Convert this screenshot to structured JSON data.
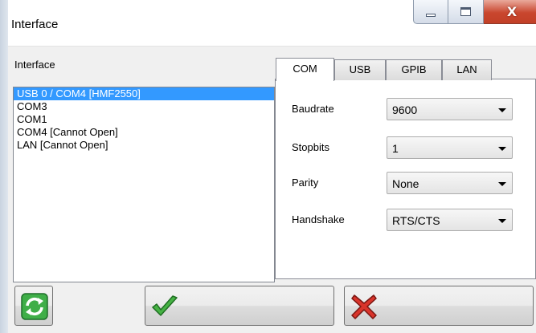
{
  "window": {
    "title": "Interface",
    "close_glyph": "X"
  },
  "interface_panel": {
    "label": "Interface",
    "items": [
      {
        "label": "USB 0 / COM4 [HMF2550]",
        "selected": true
      },
      {
        "label": "COM3",
        "selected": false
      },
      {
        "label": "COM1",
        "selected": false
      },
      {
        "label": "COM4 [Cannot Open]",
        "selected": false
      },
      {
        "label": "LAN [Cannot Open]",
        "selected": false
      }
    ]
  },
  "tabs": [
    {
      "label": "COM",
      "active": true
    },
    {
      "label": "USB",
      "active": false
    },
    {
      "label": "GPIB",
      "active": false
    },
    {
      "label": "LAN",
      "active": false
    }
  ],
  "settings": {
    "baudrate": {
      "label": "Baudrate",
      "value": "9600"
    },
    "stopbits": {
      "label": "Stopbits",
      "value": "1"
    },
    "parity": {
      "label": "Parity",
      "value": "None"
    },
    "handshake": {
      "label": "Handshake",
      "value": "RTS/CTS"
    }
  },
  "buttons": {
    "refresh_icon": "refresh-icon",
    "ok_icon": "checkmark-icon",
    "cancel_icon": "cross-icon"
  },
  "colors": {
    "selection": "#3399ff",
    "ok_green": "#3aa83a",
    "cancel_red": "#d62a2a",
    "refresh_green": "#2e9e3a"
  }
}
